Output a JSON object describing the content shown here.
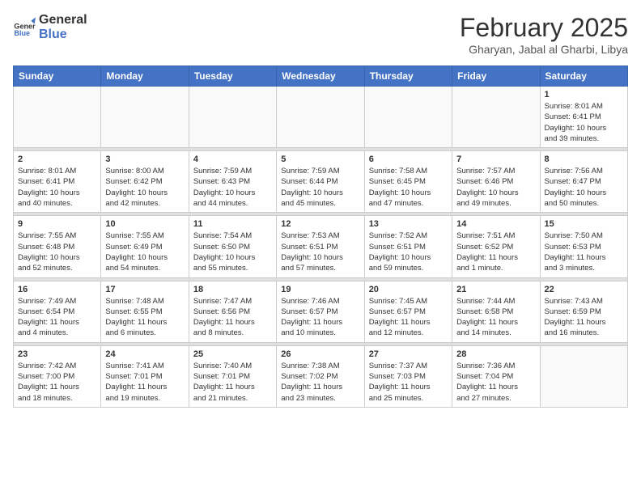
{
  "header": {
    "logo_general": "General",
    "logo_blue": "Blue",
    "month_title": "February 2025",
    "subtitle": "Gharyan, Jabal al Gharbi, Libya"
  },
  "days_of_week": [
    "Sunday",
    "Monday",
    "Tuesday",
    "Wednesday",
    "Thursday",
    "Friday",
    "Saturday"
  ],
  "weeks": [
    [
      {
        "day": "",
        "info": ""
      },
      {
        "day": "",
        "info": ""
      },
      {
        "day": "",
        "info": ""
      },
      {
        "day": "",
        "info": ""
      },
      {
        "day": "",
        "info": ""
      },
      {
        "day": "",
        "info": ""
      },
      {
        "day": "1",
        "info": "Sunrise: 8:01 AM\nSunset: 6:41 PM\nDaylight: 10 hours\nand 39 minutes."
      }
    ],
    [
      {
        "day": "2",
        "info": "Sunrise: 8:01 AM\nSunset: 6:41 PM\nDaylight: 10 hours\nand 40 minutes."
      },
      {
        "day": "3",
        "info": "Sunrise: 8:00 AM\nSunset: 6:42 PM\nDaylight: 10 hours\nand 42 minutes."
      },
      {
        "day": "4",
        "info": "Sunrise: 7:59 AM\nSunset: 6:43 PM\nDaylight: 10 hours\nand 44 minutes."
      },
      {
        "day": "5",
        "info": "Sunrise: 7:59 AM\nSunset: 6:44 PM\nDaylight: 10 hours\nand 45 minutes."
      },
      {
        "day": "6",
        "info": "Sunrise: 7:58 AM\nSunset: 6:45 PM\nDaylight: 10 hours\nand 47 minutes."
      },
      {
        "day": "7",
        "info": "Sunrise: 7:57 AM\nSunset: 6:46 PM\nDaylight: 10 hours\nand 49 minutes."
      },
      {
        "day": "8",
        "info": "Sunrise: 7:56 AM\nSunset: 6:47 PM\nDaylight: 10 hours\nand 50 minutes."
      }
    ],
    [
      {
        "day": "9",
        "info": "Sunrise: 7:55 AM\nSunset: 6:48 PM\nDaylight: 10 hours\nand 52 minutes."
      },
      {
        "day": "10",
        "info": "Sunrise: 7:55 AM\nSunset: 6:49 PM\nDaylight: 10 hours\nand 54 minutes."
      },
      {
        "day": "11",
        "info": "Sunrise: 7:54 AM\nSunset: 6:50 PM\nDaylight: 10 hours\nand 55 minutes."
      },
      {
        "day": "12",
        "info": "Sunrise: 7:53 AM\nSunset: 6:51 PM\nDaylight: 10 hours\nand 57 minutes."
      },
      {
        "day": "13",
        "info": "Sunrise: 7:52 AM\nSunset: 6:51 PM\nDaylight: 10 hours\nand 59 minutes."
      },
      {
        "day": "14",
        "info": "Sunrise: 7:51 AM\nSunset: 6:52 PM\nDaylight: 11 hours\nand 1 minute."
      },
      {
        "day": "15",
        "info": "Sunrise: 7:50 AM\nSunset: 6:53 PM\nDaylight: 11 hours\nand 3 minutes."
      }
    ],
    [
      {
        "day": "16",
        "info": "Sunrise: 7:49 AM\nSunset: 6:54 PM\nDaylight: 11 hours\nand 4 minutes."
      },
      {
        "day": "17",
        "info": "Sunrise: 7:48 AM\nSunset: 6:55 PM\nDaylight: 11 hours\nand 6 minutes."
      },
      {
        "day": "18",
        "info": "Sunrise: 7:47 AM\nSunset: 6:56 PM\nDaylight: 11 hours\nand 8 minutes."
      },
      {
        "day": "19",
        "info": "Sunrise: 7:46 AM\nSunset: 6:57 PM\nDaylight: 11 hours\nand 10 minutes."
      },
      {
        "day": "20",
        "info": "Sunrise: 7:45 AM\nSunset: 6:57 PM\nDaylight: 11 hours\nand 12 minutes."
      },
      {
        "day": "21",
        "info": "Sunrise: 7:44 AM\nSunset: 6:58 PM\nDaylight: 11 hours\nand 14 minutes."
      },
      {
        "day": "22",
        "info": "Sunrise: 7:43 AM\nSunset: 6:59 PM\nDaylight: 11 hours\nand 16 minutes."
      }
    ],
    [
      {
        "day": "23",
        "info": "Sunrise: 7:42 AM\nSunset: 7:00 PM\nDaylight: 11 hours\nand 18 minutes."
      },
      {
        "day": "24",
        "info": "Sunrise: 7:41 AM\nSunset: 7:01 PM\nDaylight: 11 hours\nand 19 minutes."
      },
      {
        "day": "25",
        "info": "Sunrise: 7:40 AM\nSunset: 7:01 PM\nDaylight: 11 hours\nand 21 minutes."
      },
      {
        "day": "26",
        "info": "Sunrise: 7:38 AM\nSunset: 7:02 PM\nDaylight: 11 hours\nand 23 minutes."
      },
      {
        "day": "27",
        "info": "Sunrise: 7:37 AM\nSunset: 7:03 PM\nDaylight: 11 hours\nand 25 minutes."
      },
      {
        "day": "28",
        "info": "Sunrise: 7:36 AM\nSunset: 7:04 PM\nDaylight: 11 hours\nand 27 minutes."
      },
      {
        "day": "",
        "info": ""
      }
    ]
  ]
}
